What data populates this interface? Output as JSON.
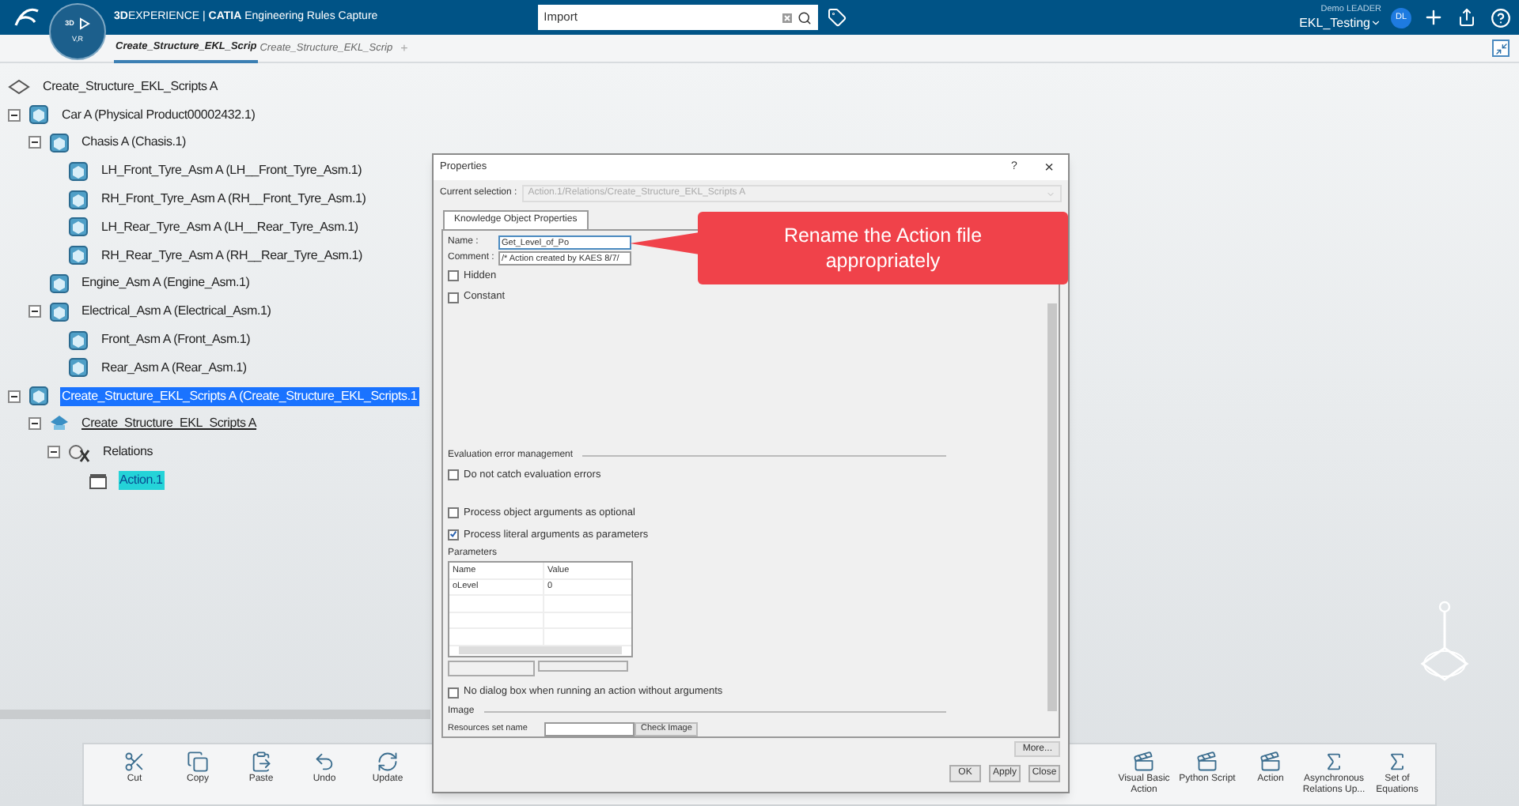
{
  "header": {
    "compass": {
      "top": "3D",
      "bottom": "V,R"
    },
    "title": "**3D**EXPERIENCE | **CATIA** Engineering Rules Capture",
    "search": {
      "value": "Import"
    },
    "user": {
      "role": "Demo LEADER",
      "space": "EKL_Testing",
      "initials": "DL"
    }
  },
  "tabs": [
    {
      "label": "Create_Structure_EKL_Scrip",
      "selected": true
    },
    {
      "label": "Create_Structure_EKL_Scrip",
      "selected": false
    }
  ],
  "add_tab": "+",
  "tree": [
    {
      "label": "Create_Structure_EKL_Scripts A",
      "kind": "root",
      "selected": false,
      "highlighted": false,
      "underlined": false,
      "children": [
        {
          "label": "Car A (Physical Product00002432.1)",
          "kind": "product",
          "expanded": true,
          "selected": false,
          "highlighted": false,
          "underlined": false,
          "children": [
            {
              "label": "Chasis A (Chasis.1)",
              "kind": "product",
              "expanded": true,
              "selected": false,
              "highlighted": false,
              "underlined": false,
              "children": [
                {
                  "label": "LH_Front_Tyre_Asm A (LH__Front_Tyre_Asm.1)",
                  "kind": "product",
                  "selected": false,
                  "highlighted": false,
                  "underlined": false
                },
                {
                  "label": "RH_Front_Tyre_Asm A (RH__Front_Tyre_Asm.1)",
                  "kind": "product",
                  "selected": false,
                  "highlighted": false,
                  "underlined": false
                },
                {
                  "label": "LH_Rear_Tyre_Asm A (LH__Rear_Tyre_Asm.1)",
                  "kind": "product",
                  "selected": false,
                  "highlighted": false,
                  "underlined": false
                },
                {
                  "label": "RH_Rear_Tyre_Asm A (RH__Rear_Tyre_Asm.1)",
                  "kind": "product",
                  "selected": false,
                  "highlighted": false,
                  "underlined": false
                }
              ]
            },
            {
              "label": "Engine_Asm A (Engine_Asm.1)",
              "kind": "product",
              "selected": false,
              "highlighted": false,
              "underlined": false
            },
            {
              "label": "Electrical_Asm A (Electrical_Asm.1)",
              "kind": "product",
              "expanded": true,
              "selected": false,
              "highlighted": false,
              "underlined": false,
              "children": [
                {
                  "label": "Front_Asm A (Front_Asm.1)",
                  "kind": "product",
                  "selected": false,
                  "highlighted": false,
                  "underlined": false
                },
                {
                  "label": "Rear_Asm A (Rear_Asm.1)",
                  "kind": "product",
                  "selected": false,
                  "highlighted": false,
                  "underlined": false
                }
              ]
            }
          ]
        },
        {
          "label": "Create_Structure_EKL_Scripts A (Create_Structure_EKL_Scripts.1",
          "kind": "product",
          "expanded": true,
          "selected": true,
          "highlighted": false,
          "underlined": false,
          "children": [
            {
              "label": "Create_Structure_EKL_Scripts A",
              "kind": "part",
              "expanded": true,
              "selected": false,
              "highlighted": false,
              "underlined": true,
              "children": [
                {
                  "label": "Relations",
                  "kind": "relations",
                  "expanded": true,
                  "selected": false,
                  "highlighted": false,
                  "underlined": false,
                  "children": [
                    {
                      "label": "Action.1",
                      "kind": "action",
                      "selected": false,
                      "highlighted": true,
                      "underlined": false
                    }
                  ]
                }
              ]
            }
          ]
        }
      ]
    }
  ],
  "dialog": {
    "title": "Properties",
    "help": "?",
    "close": "×",
    "current_selection": {
      "label": "Current selection :",
      "value": "Action.1/Relations/Create_Structure_EKL_Scripts A"
    },
    "tab": "Knowledge Object Properties",
    "name": {
      "label": "Name :",
      "value": "Get_Level_of_Po"
    },
    "comment": {
      "label": "Comment :",
      "value": "/* Action created by KAES 8/7/"
    },
    "options": [
      {
        "label": "Hidden",
        "checked": false
      },
      {
        "label": "Constant",
        "checked": false
      }
    ],
    "error_group": "Evaluation error management",
    "error_options": [
      {
        "label": "Do not catch evaluation errors",
        "checked": false
      }
    ],
    "argument_options": [
      {
        "label": "Process object arguments as optional",
        "checked": false
      },
      {
        "label": "Process literal arguments as parameters",
        "checked": true
      }
    ],
    "parameters": {
      "label": "Parameters",
      "columns": [
        "Name",
        "Value"
      ],
      "rows": [
        [
          "oLevel",
          "0"
        ]
      ]
    },
    "last_option": {
      "label": "No dialog box when running an action without arguments",
      "checked": false
    },
    "image_group": "Image",
    "resources_label": "Resources set name",
    "check_image": "Check Image",
    "more": "More...",
    "buttons": [
      "OK",
      "Apply",
      "Close"
    ]
  },
  "callout": "Rename the Action file appropriately",
  "toolbar": {
    "left": [
      {
        "label": "Cut",
        "kind": "cut"
      },
      {
        "label": "Copy",
        "kind": "copy"
      },
      {
        "label": "Paste",
        "kind": "paste"
      },
      {
        "label": "Undo",
        "kind": "undo"
      },
      {
        "label": "Update",
        "kind": "update"
      }
    ],
    "right": [
      {
        "label": "Visual Basic Action",
        "kind": "vba"
      },
      {
        "label": "Python Script",
        "kind": "python"
      },
      {
        "label": "Action",
        "kind": "action"
      },
      {
        "label": "Asynchronous Relations Up...",
        "kind": "fx"
      },
      {
        "label": "Set of Equations",
        "kind": "equations"
      }
    ]
  }
}
